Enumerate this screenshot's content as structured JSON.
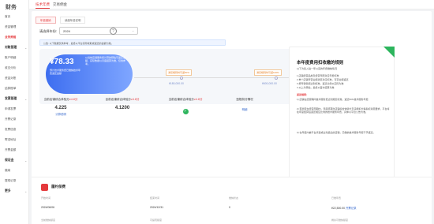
{
  "app": {
    "logo": "财务"
  },
  "sidebar": {
    "items": [
      {
        "label": "首页",
        "type": "item"
      },
      {
        "label": "资金管理",
        "type": "item"
      },
      {
        "label": "业务资格",
        "type": "active"
      },
      {
        "label": "对账管理",
        "type": "group"
      },
      {
        "label": "账户明细",
        "type": "item"
      },
      {
        "label": "收支分析",
        "type": "item"
      },
      {
        "label": "资金对账",
        "type": "item"
      },
      {
        "label": "结算账单",
        "type": "item"
      },
      {
        "label": "发票管理",
        "type": "group"
      },
      {
        "label": "申请发票",
        "type": "item"
      },
      {
        "label": "开票记录",
        "type": "item"
      },
      {
        "label": "发票信息",
        "type": "item"
      },
      {
        "label": "寄送地址",
        "type": "item"
      },
      {
        "label": "开票金额",
        "type": "item"
      },
      {
        "label": "保证金",
        "type": "group"
      },
      {
        "label": "缴纳",
        "type": "item"
      },
      {
        "label": "提现记录",
        "type": "item"
      },
      {
        "label": "更多",
        "type": "group"
      }
    ]
  },
  "topbar": {
    "tabs": [
      "技术年费",
      "交易佣金"
    ]
  },
  "subtabs": [
    "年费缴纳",
    "续缴年费说明"
  ],
  "filter": {
    "label": "请选择年份:",
    "value": "2024"
  },
  "notice": "公告: 以下数据仅供参考，最终以平台实际收取或返还的金额为准。",
  "pill": {
    "value": "¥78.33",
    "sub": "预计技术服务费已缴纳技术年费返还金额",
    "right": "以当前店铺服务费计算的预估可返还金额，实际数据以月底结算为准，仅供参考。"
  },
  "markers": [
    {
      "label": "满足规则时可返50%",
      "value": "¥180,000.00"
    },
    {
      "label": "满足规则时可返100%",
      "value": "¥600,000.00"
    }
  ],
  "metrics": [
    {
      "label": "当前店铺综合体验分",
      "suffix": "≥4.8分",
      "value": "4.225",
      "link": "计算说明"
    },
    {
      "label": "目前店铺综合体验分",
      "suffix": "≥4.8分",
      "value": "4.1200",
      "link": ""
    },
    {
      "label": "当前店铺综合体验分",
      "suffix": "≥4.8分",
      "value": "",
      "link": "",
      "check": true
    },
    {
      "label": "违规扣分情况",
      "suffix": "",
      "value": "",
      "link": "明细"
    }
  ],
  "rightpanel": {
    "ribbon": "已达标",
    "title": "本年度费用扣收缴的规则",
    "lines": [
      "以下为您入驻一年以来的年费缴纳情况",
      "1.店铺经营品类及经营年限对应年费标准",
      "2.单个店铺年营业额满足对应标准，可获全额返还",
      "3.按年销售额达到标准，返还比例以实际为准",
      "4.以上为预估，最终以官方结算为准"
    ],
    "section": "返还规则：",
    "paras": [
      "1) 店铺在经营期间技术服务费达到规定标准，返还50%技术服务年费;",
      "2) 若商家在经营周期内，年度结算时店铺综合体验分及违规扣分等指标满足要求，平台将在年度结算后返还相应比例的技术服务年费，具体以平台公告为准。",
      "3) 在年度内被平台清退或主动退出的店铺，已缴纳技术服务年费不予返还。"
    ]
  },
  "bottom": {
    "title": "履约保费",
    "headers": [
      "开始时间",
      "结束时间",
      "缴纳状态",
      "已缴年费"
    ],
    "row": [
      "2024/06/06",
      "2024/12/31",
      "0",
      "¥22,500.00"
    ],
    "row_link": "开票记录",
    "headers2": [
      "当前缴纳额度",
      "可提现额度",
      "剩余可缴纳额度"
    ]
  },
  "colors": {
    "accent": "#e4393c",
    "blue": "#3d6ef0",
    "green": "#2db55d"
  }
}
